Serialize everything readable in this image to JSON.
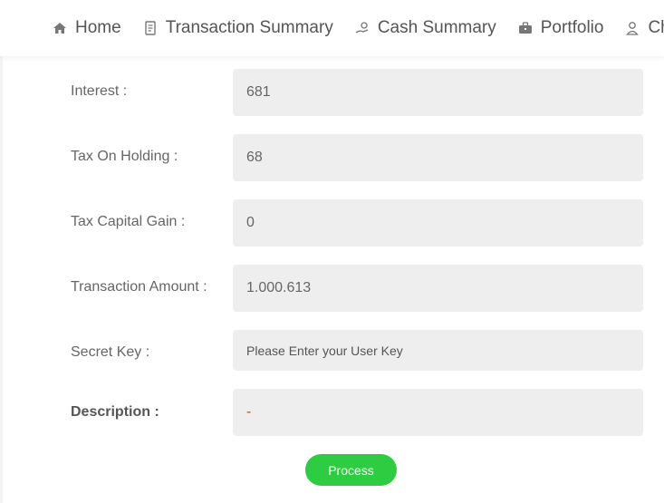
{
  "nav": {
    "items": [
      {
        "label": "Home",
        "icon": "home-icon"
      },
      {
        "label": "Transaction Summary",
        "icon": "receipt-icon"
      },
      {
        "label": "Cash Summary",
        "icon": "cash-hand-icon"
      },
      {
        "label": "Portfolio",
        "icon": "briefcase-icon"
      },
      {
        "label": "Ch",
        "icon": "user-icon"
      }
    ]
  },
  "form": {
    "interest": {
      "label": "Interest :",
      "value": "681"
    },
    "tax_on_holding": {
      "label": "Tax On Holding :",
      "value": "68"
    },
    "tax_capital_gain": {
      "label": "Tax Capital Gain :",
      "value": "0"
    },
    "transaction_amount": {
      "label": "Transaction Amount :",
      "value": "1.000.613"
    },
    "secret_key": {
      "label": "Secret Key :",
      "value": "",
      "placeholder": "Please Enter your User Key"
    },
    "description": {
      "label": "Description :",
      "value": "-"
    },
    "process_label": "Process"
  },
  "colors": {
    "accent": "#2ecc40",
    "field_bg": "#eeeeee",
    "description_value": "#c0501a"
  }
}
